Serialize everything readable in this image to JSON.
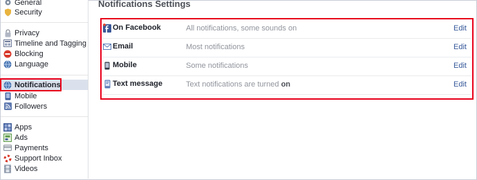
{
  "sidebar": {
    "items": [
      {
        "label": "General",
        "icon": "gear-icon",
        "color": "#7f8c9f"
      },
      {
        "label": "Security",
        "icon": "shield-icon",
        "color": "#e9b43f"
      },
      {
        "label": "Privacy",
        "icon": "lock-icon",
        "color": "#b0b6c3"
      },
      {
        "label": "Timeline and Tagging",
        "icon": "timeline-icon",
        "color": "#6b7896"
      },
      {
        "label": "Blocking",
        "icon": "block-icon",
        "color": "#d8392b"
      },
      {
        "label": "Language",
        "icon": "globe-icon",
        "color": "#4a77b4"
      },
      {
        "label": "Notifications",
        "icon": "globe-notification-icon",
        "color": "#4a77b4"
      },
      {
        "label": "Mobile",
        "icon": "mobile-icon",
        "color": "#3b5998"
      },
      {
        "label": "Followers",
        "icon": "rss-icon",
        "color": "#5f7ab0"
      },
      {
        "label": "Apps",
        "icon": "apps-icon",
        "color": "#3b5998"
      },
      {
        "label": "Ads",
        "icon": "ads-icon",
        "color": "#5b9a47"
      },
      {
        "label": "Payments",
        "icon": "card-icon",
        "color": "#8c939d"
      },
      {
        "label": "Support Inbox",
        "icon": "lifebuoy-icon",
        "color": "#d8392b"
      },
      {
        "label": "Videos",
        "icon": "film-icon",
        "color": "#7f8c9f"
      }
    ]
  },
  "main": {
    "title": "Notifications Settings",
    "rows": [
      {
        "name": "On Facebook",
        "desc": "All notifications, some sounds on",
        "desc_bold": "",
        "edit": "Edit",
        "icon": "facebook-icon"
      },
      {
        "name": "Email",
        "desc": "Most notifications",
        "desc_bold": "",
        "edit": "Edit",
        "icon": "envelope-icon"
      },
      {
        "name": "Mobile",
        "desc": "Some notifications",
        "desc_bold": "",
        "edit": "Edit",
        "icon": "phone-icon"
      },
      {
        "name": "Text message",
        "desc": "Text notifications are turned ",
        "desc_bold": "on",
        "edit": "Edit",
        "icon": "sms-phone-icon"
      }
    ]
  },
  "colors": {
    "highlight": "#e8001b",
    "link": "#365899",
    "active_bg": "#dbe1ec"
  }
}
